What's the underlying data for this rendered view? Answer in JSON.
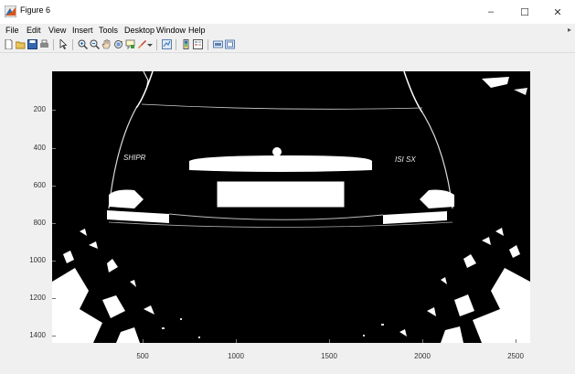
{
  "window": {
    "title": "Figure 6",
    "minimize": "–",
    "maximize": "☐",
    "close": "✕"
  },
  "menu": {
    "items": [
      "File",
      "Edit",
      "View",
      "Insert",
      "Tools",
      "Desktop",
      "Window",
      "Help"
    ]
  },
  "toolbar": {
    "buttons": [
      "new-figure-icon",
      "open-file-icon",
      "save-icon",
      "print-icon",
      "edit-plot-arrow-icon",
      "zoom-in-icon",
      "zoom-out-icon",
      "pan-hand-icon",
      "rotate-3d-icon",
      "data-cursor-icon",
      "brush-icon",
      "brush-dropdown-icon",
      "link-plot-icon",
      "insert-colorbar-icon",
      "insert-legend-icon",
      "hide-plot-tools-icon",
      "show-plot-tools-icon"
    ]
  },
  "axes": {
    "yticks": [
      "200",
      "400",
      "600",
      "800",
      "1000",
      "1200",
      "1400"
    ],
    "xticks": [
      "500",
      "1000",
      "1500",
      "2000",
      "2500"
    ]
  },
  "image": {
    "description_colors": {
      "background": "#000000",
      "foreground": "#ffffff"
    }
  }
}
